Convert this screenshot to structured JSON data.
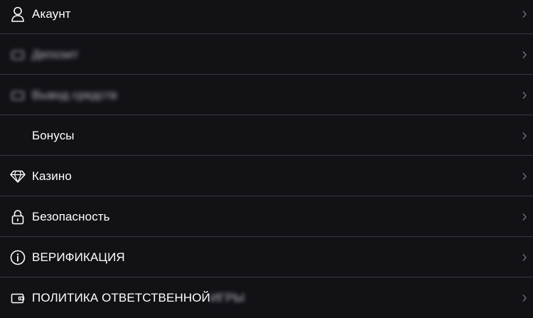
{
  "menu": {
    "items": [
      {
        "label": "Акаунт",
        "icon": "user-icon"
      },
      {
        "label": "Депозит",
        "icon": "wallet-icon"
      },
      {
        "label": "Вывод средств",
        "icon": "wallet-icon"
      },
      {
        "label": "Бонусы",
        "icon": ""
      },
      {
        "label": "Казино",
        "icon": "diamond-icon"
      },
      {
        "label": "Безопасность",
        "icon": "lock-icon"
      },
      {
        "label": "ВЕРИФИКАЦИЯ",
        "icon": "info-icon"
      },
      {
        "label_main": "ПОЛИТИКА ОТВЕТСТВЕННОЙ",
        "label_tail": "ИГРЫ",
        "icon": "wallet-card-icon"
      }
    ]
  },
  "colors": {
    "background": "#121116",
    "divider": "#3a3940",
    "text": "#ffffff",
    "chevron": "#6f6e75"
  }
}
